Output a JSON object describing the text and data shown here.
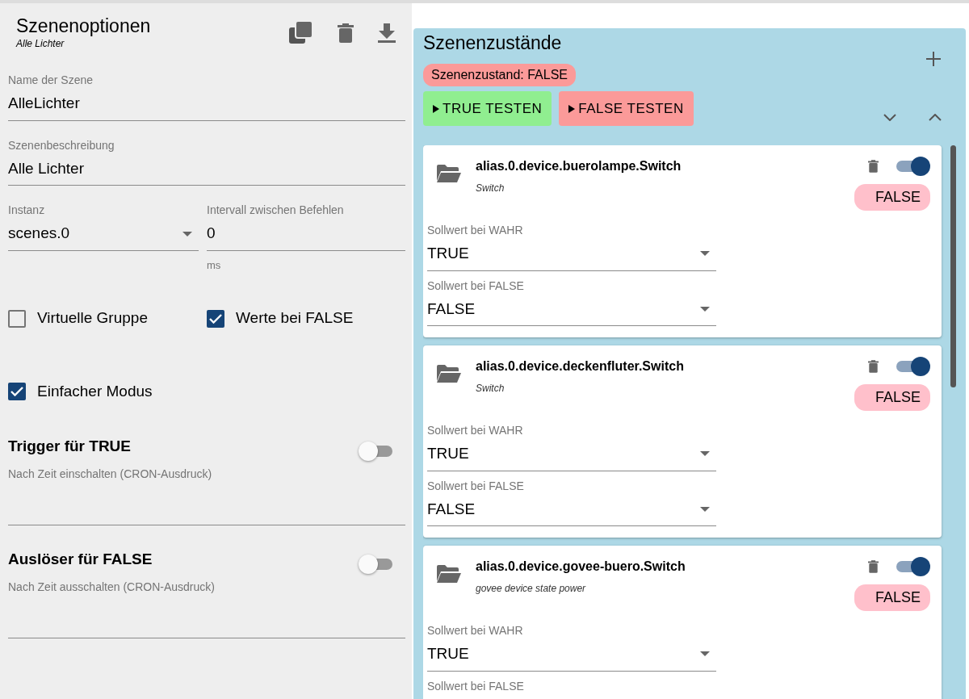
{
  "header": {
    "title": "Szenenoptionen",
    "subtitle": "Alle Lichter"
  },
  "fields": [
    {
      "label": "Name der Szene",
      "value": "AlleLichter"
    },
    {
      "label": "Szenenbeschreibung",
      "value": "Alle Lichter"
    }
  ],
  "instance": {
    "label": "Instanz",
    "value": "scenes.0"
  },
  "interval": {
    "label": "Intervall zwischen Befehlen",
    "value": "0",
    "unit": "ms"
  },
  "checkboxes": [
    {
      "label": "Virtuelle Gruppe",
      "checked": false
    },
    {
      "label": "Werte bei FALSE",
      "checked": true
    },
    {
      "label": "Einfacher Modus",
      "checked": true
    }
  ],
  "triggers": [
    {
      "title": "Trigger für TRUE",
      "on": false,
      "field_label": "Nach Zeit einschalten (CRON-Ausdruck)"
    },
    {
      "title": "Auslöser für FALSE",
      "on": false,
      "field_label": "Nach Zeit ausschalten (CRON-Ausdruck)"
    }
  ],
  "states": {
    "title": "Szenenzustände",
    "status": "Szenenzustand: FALSE",
    "test_buttons": [
      {
        "label": "TRUE TESTEN",
        "kind": "true"
      },
      {
        "label": "FALSE TESTEN",
        "kind": "false"
      }
    ],
    "members": [
      {
        "id": "alias.0.device.buerolampe.Switch",
        "description": "Switch",
        "enabled": true,
        "value": "FALSE",
        "true_label": "Sollwert bei WAHR",
        "true_value": "TRUE",
        "false_label": "Sollwert bei FALSE",
        "false_value": "FALSE"
      },
      {
        "id": "alias.0.device.deckenfluter.Switch",
        "description": "Switch",
        "enabled": true,
        "value": "FALSE",
        "true_label": "Sollwert bei WAHR",
        "true_value": "TRUE",
        "false_label": "Sollwert bei FALSE",
        "false_value": "FALSE"
      },
      {
        "id": "alias.0.device.govee-buero.Switch",
        "description": "govee device state power",
        "enabled": true,
        "value": "FALSE",
        "true_label": "Sollwert bei WAHR",
        "true_value": "TRUE",
        "false_label": "Sollwert bei FALSE"
      }
    ]
  }
}
